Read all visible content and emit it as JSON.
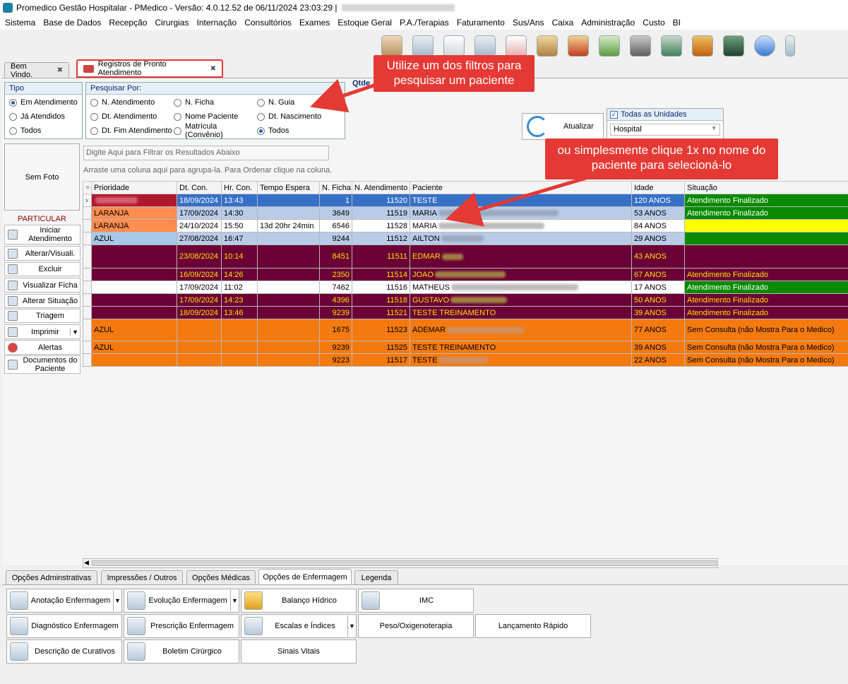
{
  "window": {
    "title": "Promedico Gestão Hospitalar - PMedico - Versão: 4.0.12.52 de 06/11/2024 23:03:29 |"
  },
  "menu": [
    "Sistema",
    "Base de Dados",
    "Recepção",
    "Cirurgias",
    "Internação",
    "Consultórios",
    "Exames",
    "Estoque Geral",
    "P.A./Terapias",
    "Faturamento",
    "Sus/Ans",
    "Caixa",
    "Administração",
    "Custo",
    "BI"
  ],
  "toolbar_icons": [
    "patients-icon",
    "doctor-icon",
    "clipboard-icon",
    "ambulance-car-icon",
    "ambulance-icon",
    "box-icon",
    "dollar-up-icon",
    "money-down-icon",
    "safe-icon",
    "cashier-icon",
    "phone-book-icon",
    "book-icon",
    "chat-icon",
    "window-icon"
  ],
  "doc_tabs": [
    {
      "label": "Bem Vindo."
    },
    {
      "label": "Registros de Pronto Atendimento"
    }
  ],
  "tipo": {
    "title": "Tipo",
    "options": [
      {
        "label": "Em Atendimento",
        "checked": true
      },
      {
        "label": "Já Atendidos",
        "checked": false
      },
      {
        "label": "Todos",
        "checked": false
      }
    ]
  },
  "pesquisar": {
    "title": "Pesquisar Por:",
    "options": [
      {
        "label": "N. Atendimento",
        "checked": false
      },
      {
        "label": "N. Ficha",
        "checked": false
      },
      {
        "label": "N. Guia",
        "checked": false
      },
      {
        "label": "Dt. Atendimento",
        "checked": false
      },
      {
        "label": "Nome Paciente",
        "checked": false
      },
      {
        "label": "Dt. Nascimento",
        "checked": false
      },
      {
        "label": "Dt. Fim Atendimento",
        "checked": false
      },
      {
        "label": "Matrícula (Convênio)",
        "checked": false
      },
      {
        "label": "Todos",
        "checked": true
      }
    ]
  },
  "qtde_label": "Qtde",
  "atualizar_label": "Atualizar",
  "unidades": {
    "label": "Todas as Unidades",
    "checked": true,
    "selected": "Hospital"
  },
  "photo_label": "Sem Foto",
  "filter_placeholder": "Digite Aqui para Filtrar os Resultados Abaixo",
  "group_hint": "Arraste uma coluna aqui para agrupa-la. Para Ordenar clique na coluna.",
  "convenio_label": "PARTICULAR",
  "side_buttons": [
    "Iniciar Atendimento",
    "Alterar/Visuali.",
    "Excluir",
    "Visualizar Ficha",
    "Alterar Situação",
    "Triagem",
    "Imprimir",
    "Alertas",
    "Documentos do Paciente"
  ],
  "grid": {
    "columns": [
      "Prioridade",
      "Dt. Con.",
      "Hr. Con.",
      "Tempo Espera",
      "N. Ficha",
      "N. Atendimento",
      "Paciente",
      "Idade",
      "Situação"
    ],
    "rows": [
      {
        "prioridade": "",
        "dt": "18/09/2024",
        "hr": "13:43",
        "espera": "",
        "ficha": "1",
        "atend": "11520",
        "paciente": "TESTE",
        "idade": "120 ANOS",
        "situacao": "Atendimento Finalizado"
      },
      {
        "prioridade": "LARANJA",
        "dt": "17/09/2024",
        "hr": "14:30",
        "espera": "",
        "ficha": "3649",
        "atend": "11519",
        "paciente": "MARIA",
        "idade": "53 ANOS",
        "situacao": "Atendimento Finalizado"
      },
      {
        "prioridade": "LARANJA",
        "dt": "24/10/2024",
        "hr": "15:50",
        "espera": "13d 20hr 24min",
        "ficha": "6546",
        "atend": "11528",
        "paciente": "MARIA",
        "idade": "84 ANOS",
        "situacao": ""
      },
      {
        "prioridade": "AZUL",
        "dt": "27/08/2024",
        "hr": "16:47",
        "espera": "",
        "ficha": "9244",
        "atend": "11512",
        "paciente": "AILTON",
        "idade": "29 ANOS",
        "situacao": ""
      },
      {
        "prioridade": "",
        "dt": "23/08/2024",
        "hr": "10:14",
        "espera": "",
        "ficha": "8451",
        "atend": "11511",
        "paciente": "EDMAR",
        "idade": "43 ANOS",
        "situacao": ""
      },
      {
        "prioridade": "",
        "dt": "16/09/2024",
        "hr": "14:26",
        "espera": "",
        "ficha": "2350",
        "atend": "11514",
        "paciente": "JOAO",
        "idade": "67 ANOS",
        "situacao": "Atendimento Finalizado"
      },
      {
        "prioridade": "",
        "dt": "17/09/2024",
        "hr": "11:02",
        "espera": "",
        "ficha": "7462",
        "atend": "11516",
        "paciente": "MATHEUS",
        "idade": "17 ANOS",
        "situacao": "Atendimento Finalizado"
      },
      {
        "prioridade": "",
        "dt": "17/09/2024",
        "hr": "14:23",
        "espera": "",
        "ficha": "4396",
        "atend": "11518",
        "paciente": "GUSTAVO",
        "idade": "50 ANOS",
        "situacao": "Atendimento Finalizado"
      },
      {
        "prioridade": "",
        "dt": "18/09/2024",
        "hr": "13:46",
        "espera": "",
        "ficha": "9239",
        "atend": "11521",
        "paciente": "TESTE TREINAMENTO",
        "idade": "39 ANOS",
        "situacao": "Atendimento Finalizado"
      },
      {
        "prioridade": "AZUL",
        "dt": "",
        "hr": "",
        "espera": "",
        "ficha": "1675",
        "atend": "11523",
        "paciente": "ADEMAR",
        "idade": "77 ANOS",
        "situacao": "Sem Consulta (não Mostra Para o Medico)"
      },
      {
        "prioridade": "AZUL",
        "dt": "",
        "hr": "",
        "espera": "",
        "ficha": "9239",
        "atend": "11525",
        "paciente": "TESTE TREINAMENTO",
        "idade": "39 ANOS",
        "situacao": "Sem Consulta (não Mostra Para o Medico)"
      },
      {
        "prioridade": "",
        "dt": "",
        "hr": "",
        "espera": "",
        "ficha": "9223",
        "atend": "11517",
        "paciente": "TESTE",
        "idade": "22 ANOS",
        "situacao": "Sem Consulta (não Mostra Para o Medico)"
      }
    ]
  },
  "bottom_tabs": [
    "Opções Adminstrativas",
    "Impressões / Outros",
    "Opções Médicas",
    "Opções de Enfermagem",
    "Legenda"
  ],
  "nursing_buttons": [
    "Anotação Enfermagem",
    "Evolução Enfermagem",
    "Balanço Hídrico",
    "IMC",
    "Diagnóstico Enfermagem",
    "Prescrição Enfermagem",
    "Escalas e Índices",
    "Peso/Oxigenoterapia",
    "Lançamento Rápido",
    "Descrição de Curativos",
    "Boletim Cirúrgico",
    "Sinais Vitais"
  ],
  "callouts": {
    "filters": "Utilize um dos filtros para pesquisar um paciente",
    "click": "ou simplesmente clique 1x no nome do paciente para selecioná-lo"
  },
  "colors": {
    "accent": "#e53935",
    "selected": "#3670c8",
    "maroon": "#6b0036",
    "orange": "#f47a10",
    "green": "#0a8a00",
    "yellow": "#ffff00",
    "lightblue": "#b8cce8",
    "laranja": "#ff8c50",
    "azul": "#a8c8e8"
  }
}
